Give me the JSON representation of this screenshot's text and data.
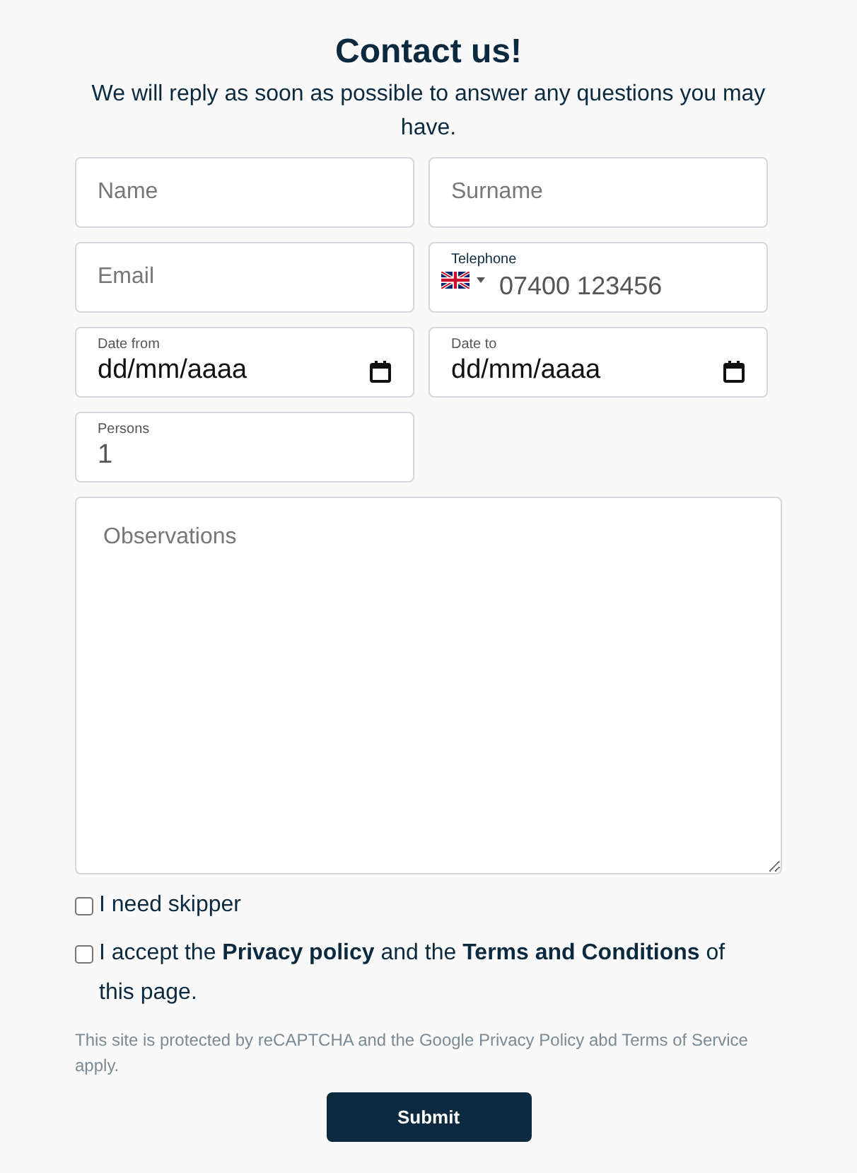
{
  "title": "Contact us!",
  "subtitle": "We will reply as soon as possible to answer any questions you may have.",
  "field_rows": [
    [
      {
        "kind": "text",
        "placeholder": "Name"
      },
      {
        "kind": "text",
        "placeholder": "Surname"
      }
    ],
    [
      {
        "kind": "text",
        "placeholder": "Email"
      },
      {
        "kind": "phone",
        "label": "Telephone",
        "placeholder": "07400 123456"
      }
    ],
    [
      {
        "kind": "date",
        "label": "Date from",
        "value": "dd/mm/aaaa"
      },
      {
        "kind": "date",
        "label": "Date to",
        "value": "dd/mm/aaaa"
      }
    ],
    [
      {
        "kind": "number",
        "label": "Persons",
        "value": "1"
      }
    ]
  ],
  "observations": {
    "placeholder": "Observations"
  },
  "checkboxes": [
    {
      "label": "I need skipper",
      "checked": false
    },
    {
      "label": "I accept the **Privacy policy** and the **Terms and Conditions** of this page.",
      "checked": false
    }
  ],
  "notice": "This site is protected by reCAPTCHA and the Google Privacy Policy abd Terms of Service apply.",
  "submit": "Submit"
}
